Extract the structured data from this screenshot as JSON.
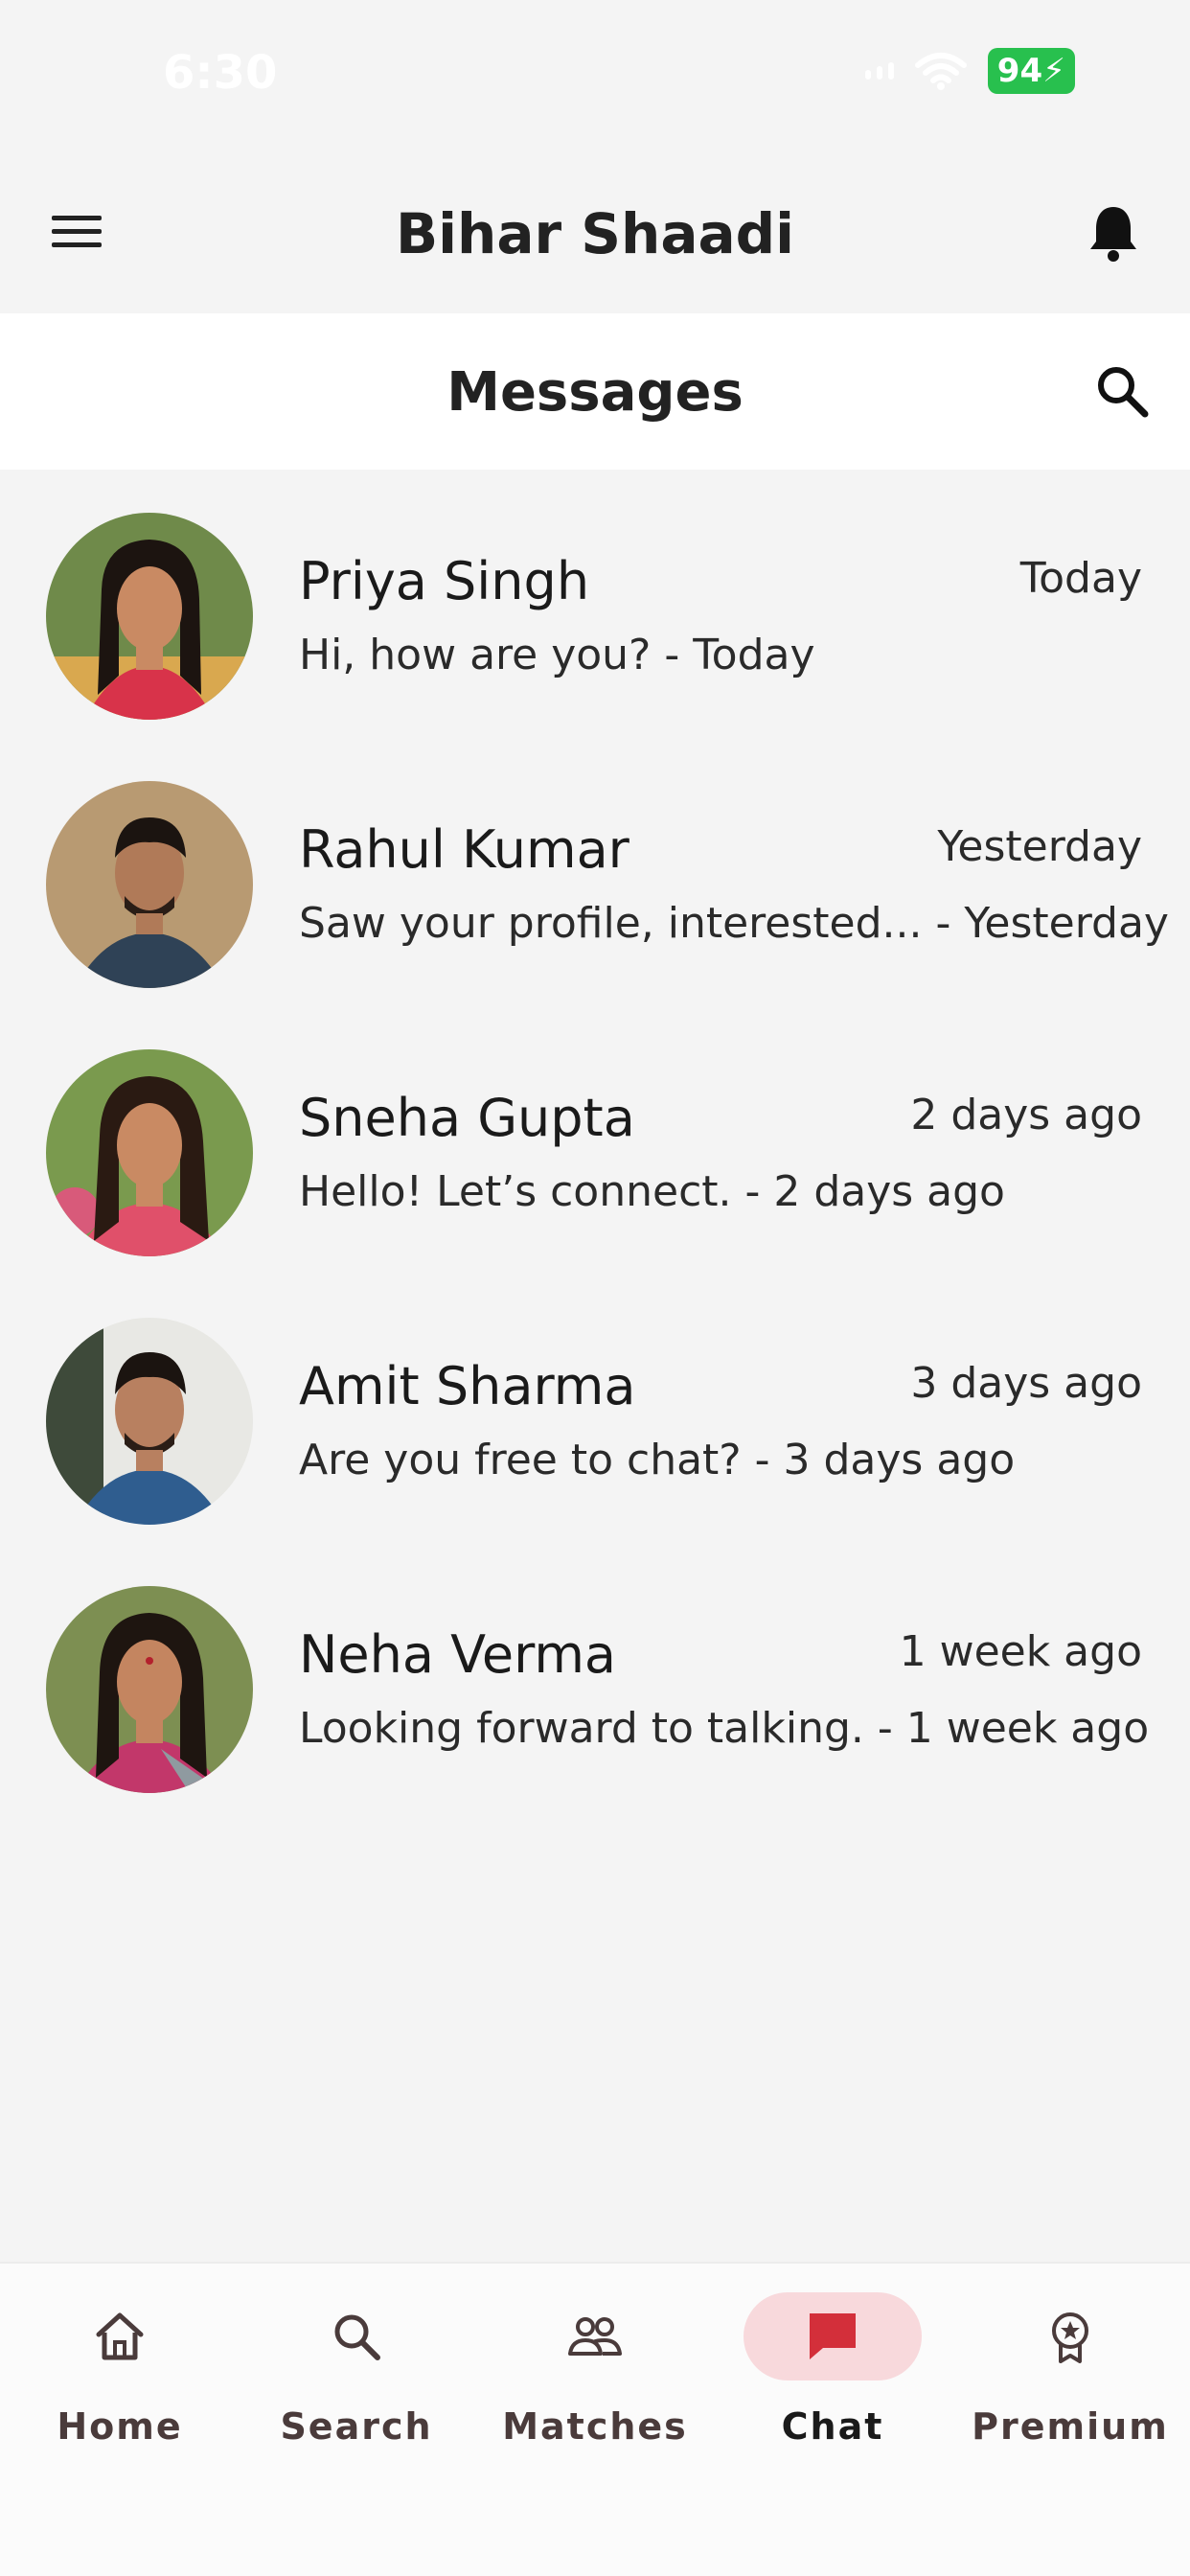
{
  "status_bar": {
    "time": "6:30",
    "battery": "94"
  },
  "header": {
    "title": "Bihar Shaadi"
  },
  "messages_bar": {
    "title": "Messages"
  },
  "chats": [
    {
      "name": "Priya Singh",
      "time": "Today",
      "preview": "Hi, how are you? - Today"
    },
    {
      "name": "Rahul Kumar",
      "time": "Yesterday",
      "preview": "Saw your profile, interested... - Yesterday"
    },
    {
      "name": "Sneha Gupta",
      "time": "2 days ago",
      "preview": "Hello! Let’s connect. - 2 days ago"
    },
    {
      "name": "Amit Sharma",
      "time": "3 days ago",
      "preview": "Are you free to chat? - 3 days ago"
    },
    {
      "name": "Neha Verma",
      "time": "1 week ago",
      "preview": "Looking forward to talking. - 1 week ago"
    }
  ],
  "nav": [
    {
      "label": "Home",
      "icon": "home-icon"
    },
    {
      "label": "Search",
      "icon": "search-icon"
    },
    {
      "label": "Matches",
      "icon": "people-icon"
    },
    {
      "label": "Chat",
      "icon": "chat-icon",
      "active": true
    },
    {
      "label": "Premium",
      "icon": "premium-badge-icon"
    }
  ],
  "colors": {
    "accent": "#d32f3a",
    "active_pill": "#f8d9dc",
    "battery": "#28c04e"
  }
}
